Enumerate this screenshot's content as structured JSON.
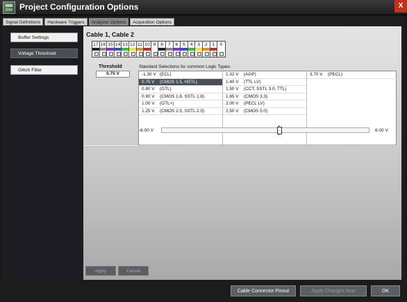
{
  "window": {
    "title": "Project Configuration Options",
    "close_label": "X"
  },
  "tabs": [
    {
      "label": "Signal Definitions"
    },
    {
      "label": "Hardware Triggers"
    },
    {
      "label": "Analyzer Options"
    },
    {
      "label": "Acquisition Options"
    }
  ],
  "sidebar": {
    "items": [
      {
        "label": "Buffer Settings"
      },
      {
        "label": "Voltage Threshold"
      },
      {
        "label": "Glitch Filter"
      }
    ]
  },
  "main": {
    "cable_title": "Cable 1, Cable 2",
    "channels": [
      {
        "num": "17",
        "color": "#222222"
      },
      {
        "num": "16",
        "color": "#888888"
      },
      {
        "num": "15",
        "color": "#8a2be2"
      },
      {
        "num": "14",
        "color": "#2b4dd8"
      },
      {
        "num": "13",
        "color": "#27c43a"
      },
      {
        "num": "12",
        "color": "#f3e52b"
      },
      {
        "num": "11",
        "color": "#f08a1d"
      },
      {
        "num": "10",
        "color": "#d8261e"
      },
      {
        "num": "9",
        "color": "#ffffff"
      },
      {
        "num": "8",
        "color": "#222222"
      },
      {
        "num": "7",
        "color": "#888888"
      },
      {
        "num": "6",
        "color": "#8a2be2"
      },
      {
        "num": "5",
        "color": "#2b4dd8"
      },
      {
        "num": "4",
        "color": "#27c43a"
      },
      {
        "num": "3",
        "color": "#f3e52b"
      },
      {
        "num": "2",
        "color": "#f08a1d"
      },
      {
        "num": "1",
        "color": "#d8261e"
      },
      {
        "num": "0",
        "color": "#ffffff"
      }
    ],
    "threshold_label": "Threshold",
    "threshold_value": "0.75 V",
    "standard_label": "Standard Selections for common Logic Types:",
    "columns": [
      [
        {
          "v": "-1.30 V",
          "t": "(ECL)"
        },
        {
          "v": "0.75 V",
          "t": "(CMOS 1.5, HSTL)"
        },
        {
          "v": "0.80 V",
          "t": "(GTL)"
        },
        {
          "v": "0.90 V",
          "t": "(CMOS 1.8, SSTL 1.8)"
        },
        {
          "v": "1.00 V",
          "t": "(GTL+)"
        },
        {
          "v": "1.25 V",
          "t": "(CMOS 2.5, SSTL 2.0)"
        }
      ],
      [
        {
          "v": "1.32 V",
          "t": "(AGP)"
        },
        {
          "v": "1.40 V",
          "t": "(TTL LV)"
        },
        {
          "v": "1.50 V",
          "t": "(CCT, SSTL 3.0, TTL)"
        },
        {
          "v": "1.65 V",
          "t": "(CMOS 3.3)"
        },
        {
          "v": "2.00 V",
          "t": "(PECL LV)"
        },
        {
          "v": "2.50 V",
          "t": "(CMOS 5.0)"
        }
      ],
      [
        {
          "v": "3.70 V",
          "t": "(PECL)"
        }
      ]
    ],
    "slider": {
      "min_label": "-6.00 V",
      "max_label": "6.00 V",
      "value_fraction": 0.5625
    },
    "apply_label": "Apply",
    "cancel_label": "Cancel"
  },
  "footer": {
    "pinout_label": "Cable Connector Pinout",
    "apply_changes_label": "Apply Changes Now",
    "ok_label": "OK"
  }
}
